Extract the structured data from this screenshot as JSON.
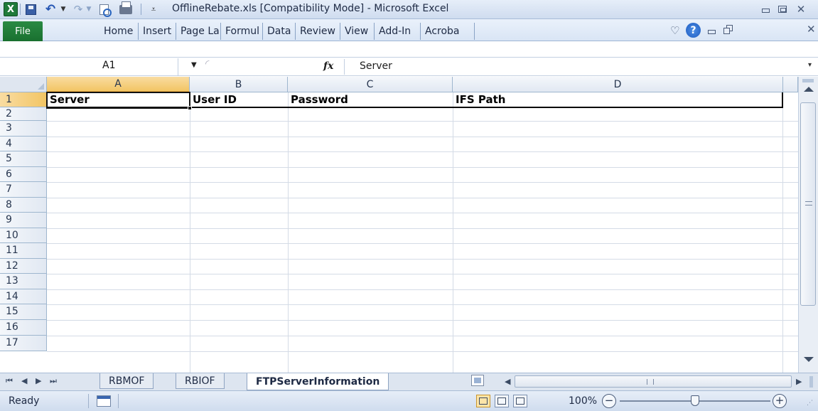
{
  "window": {
    "title": "OfflineRebate.xls  [Compatibility Mode]  -  Microsoft Excel",
    "app_icon": "excel-icon"
  },
  "ribbon": {
    "file_label": "File",
    "tabs": [
      "Home",
      "Insert",
      "Page La",
      "Formul",
      "Data",
      "Review",
      "View",
      "Add-In",
      "Acroba"
    ]
  },
  "formula_bar": {
    "name_box": "A1",
    "fx_label": "fx",
    "formula": "Server"
  },
  "grid": {
    "columns": [
      "A",
      "B",
      "C",
      "D"
    ],
    "rows": [
      "1",
      "2",
      "3",
      "4",
      "5",
      "6",
      "7",
      "8",
      "9",
      "10",
      "11",
      "12",
      "13",
      "14",
      "15",
      "16",
      "17"
    ],
    "header_row": [
      "Server",
      "User ID",
      "Password",
      "IFS Path"
    ],
    "active_cell": "A1"
  },
  "sheets": {
    "tabs": [
      "RBMOF",
      "RBIOF",
      "FTPServerInformation"
    ],
    "active": "FTPServerInformation"
  },
  "status": {
    "ready": "Ready",
    "zoom": "100%",
    "zoom_percent": 100
  },
  "colors": {
    "accent_green": "#1f7a3a",
    "selection_header": "#f2c564",
    "grid_line": "#d4dbe6"
  }
}
